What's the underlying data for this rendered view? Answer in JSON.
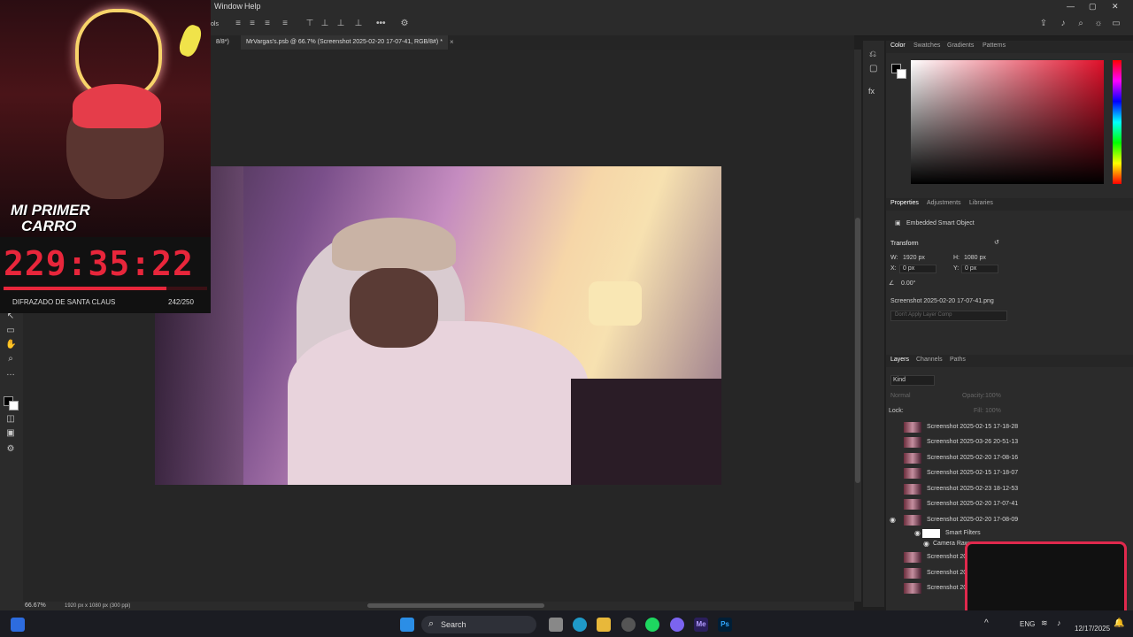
{
  "menubar": {
    "items": [
      "Window",
      "Help"
    ]
  },
  "tabs": [
    {
      "label": "8/8*)"
    },
    {
      "label": "MrVargas's.psb @ 66.7% (Screenshot 2025-02-20 17-07-41, RGB/8#) *"
    }
  ],
  "options": {
    "cut_label": "ols"
  },
  "status": {
    "zoom": "66.67%",
    "doc_info": "1920 px x 1080 px (300 ppi)"
  },
  "overlay": {
    "logo_text_1": "MI PRIMER",
    "logo_text_2": "CARRO",
    "timer": "229:35:22",
    "caption": "DIFRAZADO DE SANTA CLAUS",
    "count": "242/250",
    "progress": 0.8
  },
  "color_panel": {
    "tabs": [
      "Color",
      "Swatches",
      "Gradients",
      "Patterns"
    ]
  },
  "properties": {
    "tabs": [
      "Properties",
      "Adjustments",
      "Libraries"
    ],
    "type": "Embedded Smart Object",
    "transform_label": "Transform",
    "w_label": "W:",
    "w_value": "1920 px",
    "h_label": "H:",
    "h_value": "1080 px",
    "x_label": "X:",
    "x_value": "0 px",
    "y_label": "Y:",
    "y_value": "0 px",
    "angle_value": "0.00°",
    "file_name": "Screenshot 2025-02-20 17-07-41.png",
    "layer_comps": "Don't Apply Layer Comp"
  },
  "layers": {
    "tabs": [
      "Layers",
      "Channels",
      "Paths"
    ],
    "filter": "Kind",
    "blend": "Normal",
    "opacity_label": "Opacity:",
    "opacity_value": "100%",
    "lock_label": "Lock:",
    "fill_label": "Fill:",
    "fill_value": "100%",
    "rows": [
      "Screenshot 2025-02-15 17-18-28",
      "Screenshot 2025-03-26 20-51-13",
      "Screenshot 2025-02-20 17-08-16",
      "Screenshot 2025-02-15 17-18-07",
      "Screenshot 2025-02-23 18-12-53",
      "Screenshot 2025-02-20 17-07-41",
      "Screenshot 2025-02-20 17-08-09"
    ],
    "smart_filters": "Smart Filters",
    "camera_raw": "Camera Raw",
    "trailing_rows": [
      "Screenshot 20",
      "Screenshot 20",
      "Screenshot 20"
    ]
  },
  "taskbar": {
    "search_label": "Search",
    "lang": "ENG",
    "date": "12/17/2025",
    "app_labels": [
      "Me",
      "Ps"
    ]
  },
  "colors": {
    "accent_red": "#e8263b",
    "panel_bg": "#2b2b2b",
    "highlight": "#e0294d"
  }
}
